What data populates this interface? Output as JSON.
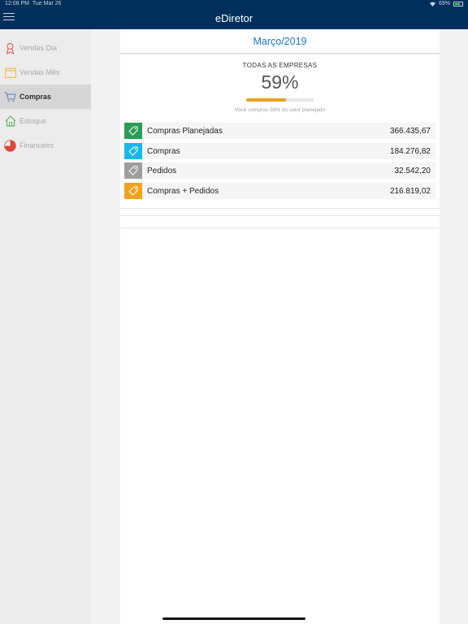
{
  "status_bar": {
    "time": "12:08 PM",
    "date": "Tue Mar 26",
    "battery": "69%"
  },
  "nav": {
    "title": "eDiretor"
  },
  "sidebar": {
    "items": [
      {
        "label": "Vendas Dia",
        "icon": "person-badge-icon",
        "color": "#e06a63"
      },
      {
        "label": "Vendas Mês",
        "icon": "calendar-icon",
        "color": "#f2c14e"
      },
      {
        "label": "Compras",
        "icon": "cart-icon",
        "color": "#6b8fbf"
      },
      {
        "label": "Estoque",
        "icon": "house-icon",
        "color": "#5fb85f"
      },
      {
        "label": "Financeiro",
        "icon": "pie-chart-icon",
        "color": "#e0463a"
      }
    ],
    "active": "Compras"
  },
  "main": {
    "month": "Março/2019",
    "summary_title": "TODAS AS EMPRESAS",
    "percent": "59%",
    "progress_fraction": 0.59,
    "note": "Você comprou 59% do valor planejado",
    "rows": [
      {
        "label": "Compras Planejadas",
        "value": "366.435,67",
        "color": "#2a9d55",
        "icon": "tag-icon"
      },
      {
        "label": "Compras",
        "value": "184.276,82",
        "color": "#1ab7ea",
        "icon": "tag-icon"
      },
      {
        "label": "Pedidos",
        "value": "32.542,20",
        "color": "#9e9e9e",
        "icon": "tag-icon"
      },
      {
        "label": "Compras + Pedidos",
        "value": "216.819,02",
        "color": "#f2a21c",
        "icon": "tag-icon"
      }
    ]
  }
}
